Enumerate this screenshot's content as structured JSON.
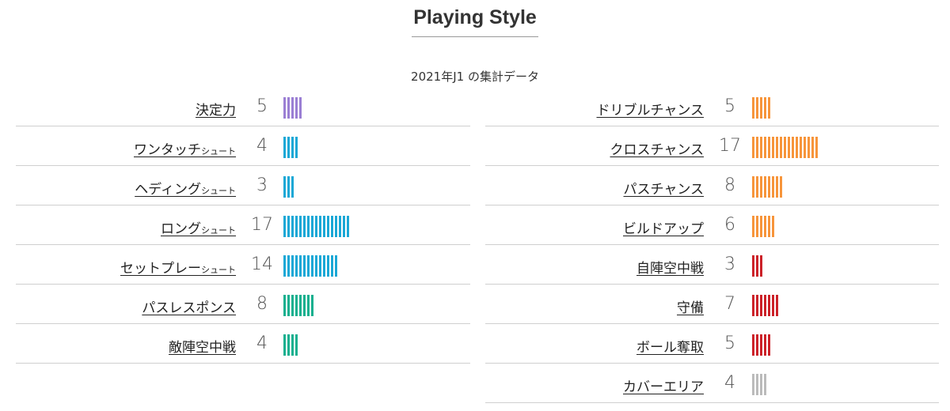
{
  "header": {
    "title": "Playing Style",
    "subtitle": "2021年J1 の集計データ"
  },
  "colors": {
    "purple": "#9b7fd4",
    "blue": "#1ba8d6",
    "teal": "#17b08f",
    "orange": "#f7953b",
    "red": "#cc2229",
    "gray": "#bbbbbb"
  },
  "chart_data": {
    "type": "bar",
    "title": "Playing Style",
    "subtitle": "2021年J1 の集計データ",
    "columns": [
      {
        "rows": [
          {
            "label": "決定力",
            "suffix": "",
            "value": 5,
            "color": "purple"
          },
          {
            "label": "ワンタッチ",
            "suffix": "シュート",
            "value": 4,
            "color": "blue"
          },
          {
            "label": "ヘディング",
            "suffix": "シュート",
            "value": 3,
            "color": "blue"
          },
          {
            "label": "ロング",
            "suffix": "シュート",
            "value": 17,
            "color": "blue"
          },
          {
            "label": "セットプレー",
            "suffix": "シュート",
            "value": 14,
            "color": "blue"
          },
          {
            "label": "パスレスポンス",
            "suffix": "",
            "value": 8,
            "color": "teal"
          },
          {
            "label": "敵陣空中戦",
            "suffix": "",
            "value": 4,
            "color": "teal"
          }
        ]
      },
      {
        "rows": [
          {
            "label": "ドリブルチャンス",
            "suffix": "",
            "value": 5,
            "color": "orange"
          },
          {
            "label": "クロスチャンス",
            "suffix": "",
            "value": 17,
            "color": "orange"
          },
          {
            "label": "パスチャンス",
            "suffix": "",
            "value": 8,
            "color": "orange"
          },
          {
            "label": "ビルドアップ",
            "suffix": "",
            "value": 6,
            "color": "orange"
          },
          {
            "label": "自陣空中戦",
            "suffix": "",
            "value": 3,
            "color": "red"
          },
          {
            "label": "守備",
            "suffix": "",
            "value": 7,
            "color": "red"
          },
          {
            "label": "ボール奪取",
            "suffix": "",
            "value": 5,
            "color": "red"
          },
          {
            "label": "カバーエリア",
            "suffix": "",
            "value": 4,
            "color": "gray"
          }
        ]
      }
    ]
  }
}
